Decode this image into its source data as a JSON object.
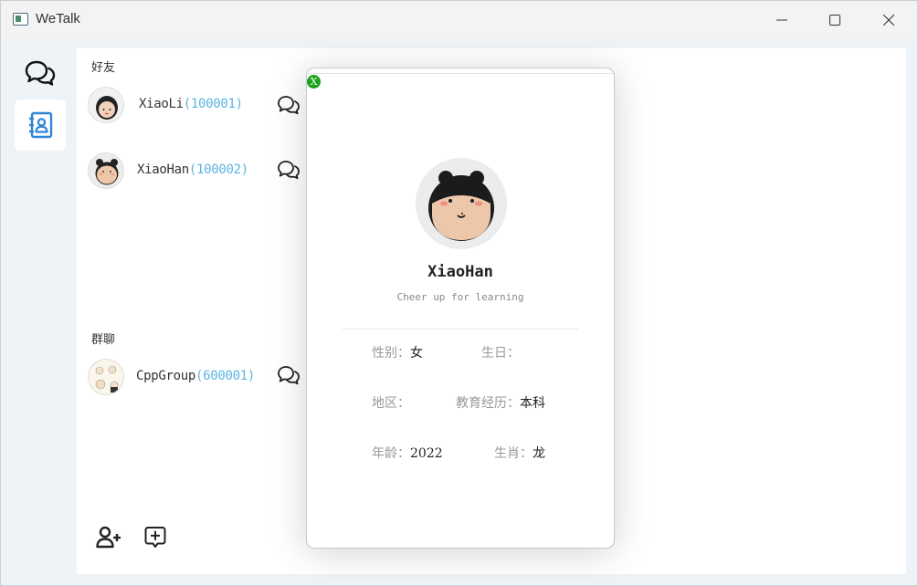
{
  "window": {
    "title": "WeTalk"
  },
  "sidebar": {
    "items": [
      {
        "name": "messages"
      },
      {
        "name": "contacts",
        "active": true
      }
    ]
  },
  "contacts": {
    "friends_title": "好友",
    "friends": [
      {
        "name": "XiaoLi",
        "id": "(100001)"
      },
      {
        "name": "XiaoHan",
        "id": "(100002)"
      }
    ],
    "groups_title": "群聊",
    "groups": [
      {
        "name": "CppGroup",
        "id": "(600001)"
      }
    ]
  },
  "profile": {
    "close_label": "X",
    "name": "XiaoHan",
    "signature": "Cheer up for learning",
    "gender_label": "性别：",
    "gender": "女",
    "birthday_label": "生日：",
    "birthday": "",
    "region_label": "地区：",
    "region": "",
    "education_label": "教育经历：",
    "education": "本科",
    "age_label": "年龄：",
    "age": "2022",
    "zodiac_label": "生肖：",
    "zodiac": "龙"
  },
  "colors": {
    "accent": "#5ab4e0",
    "contacts_icon": "#2f86d6",
    "close_button": "#1aa31a"
  }
}
